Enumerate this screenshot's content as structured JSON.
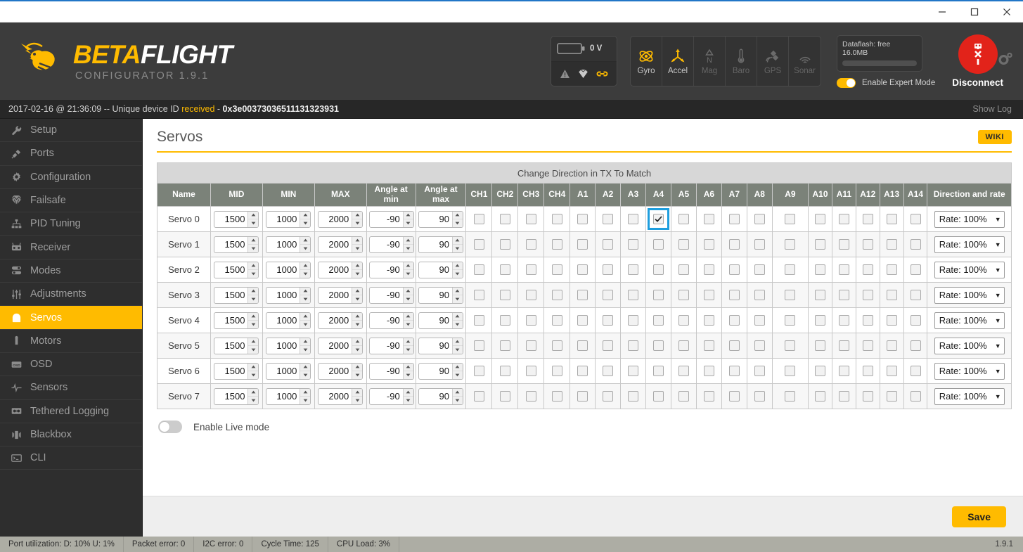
{
  "window": {
    "minimize_label": "minimize",
    "maximize_label": "maximize",
    "close_label": "close"
  },
  "header": {
    "brand_first": "BETA",
    "brand_second": "FLIGHT",
    "subtitle": "CONFIGURATOR  1.9.1",
    "battery": {
      "voltage": "0 V"
    },
    "sensors": [
      {
        "name": "Gyro",
        "label": "Gyro",
        "active": true
      },
      {
        "name": "Accel",
        "label": "Accel",
        "active": true
      },
      {
        "name": "Mag",
        "label": "Mag",
        "active": false
      },
      {
        "name": "Baro",
        "label": "Baro",
        "active": false
      },
      {
        "name": "GPS",
        "label": "GPS",
        "active": false
      },
      {
        "name": "Sonar",
        "label": "Sonar",
        "active": false
      }
    ],
    "dataflash_label": "Dataflash: free 16.0MB",
    "expert_mode_label": "Enable Expert Mode",
    "expert_mode_on": true,
    "disconnect_label": "Disconnect"
  },
  "log": {
    "timestamp": "2017-02-16 @ 21:36:09",
    "separator": " -- ",
    "message": "Unique device ID ",
    "status_word": "received",
    "dash": " - ",
    "device_id": "0x3e00373036511131323931",
    "show_log_label": "Show Log"
  },
  "sidebar": {
    "items": [
      {
        "label": "Setup",
        "icon": "wrench-icon",
        "active": false
      },
      {
        "label": "Ports",
        "icon": "plug-icon",
        "active": false
      },
      {
        "label": "Configuration",
        "icon": "gear-icon",
        "active": false
      },
      {
        "label": "Failsafe",
        "icon": "parachute-icon",
        "active": false
      },
      {
        "label": "PID Tuning",
        "icon": "sitemap-icon",
        "active": false
      },
      {
        "label": "Receiver",
        "icon": "transmitter-icon",
        "active": false
      },
      {
        "label": "Modes",
        "icon": "switches-icon",
        "active": false
      },
      {
        "label": "Adjustments",
        "icon": "sliders-icon",
        "active": false
      },
      {
        "label": "Servos",
        "icon": "servo-icon",
        "active": true
      },
      {
        "label": "Motors",
        "icon": "motor-icon",
        "active": false
      },
      {
        "label": "OSD",
        "icon": "osd-icon",
        "active": false
      },
      {
        "label": "Sensors",
        "icon": "waveform-icon",
        "active": false
      },
      {
        "label": "Tethered Logging",
        "icon": "cassette-icon",
        "active": false
      },
      {
        "label": "Blackbox",
        "icon": "blackbox-icon",
        "active": false
      },
      {
        "label": "CLI",
        "icon": "terminal-icon",
        "active": false
      }
    ]
  },
  "page": {
    "title": "Servos",
    "wiki_label": "WIKI",
    "band_label": "Change Direction in TX To Match",
    "live_mode_label": "Enable Live mode",
    "live_mode_on": false,
    "save_label": "Save"
  },
  "table": {
    "columns": [
      "Name",
      "MID",
      "MIN",
      "MAX",
      "Angle at min",
      "Angle at max",
      "CH1",
      "CH2",
      "CH3",
      "CH4",
      "A1",
      "A2",
      "A3",
      "A4",
      "A5",
      "A6",
      "A7",
      "A8",
      "A9",
      "A10",
      "A11",
      "A12",
      "A13",
      "A14",
      "Direction and rate"
    ],
    "channel_columns": [
      "CH1",
      "CH2",
      "CH3",
      "CH4",
      "A1",
      "A2",
      "A3",
      "A4",
      "A5",
      "A6",
      "A7",
      "A8",
      "A9",
      "A10",
      "A11",
      "A12",
      "A13",
      "A14"
    ],
    "rows": [
      {
        "name": "Servo 0",
        "mid": "1500",
        "min": "1000",
        "max": "2000",
        "angle_min": "-90",
        "angle_max": "90",
        "checked": [
          "A4"
        ],
        "focused": "A4",
        "rate": "Rate: 100%"
      },
      {
        "name": "Servo 1",
        "mid": "1500",
        "min": "1000",
        "max": "2000",
        "angle_min": "-90",
        "angle_max": "90",
        "checked": [],
        "focused": "",
        "rate": "Rate: 100%"
      },
      {
        "name": "Servo 2",
        "mid": "1500",
        "min": "1000",
        "max": "2000",
        "angle_min": "-90",
        "angle_max": "90",
        "checked": [],
        "focused": "",
        "rate": "Rate: 100%"
      },
      {
        "name": "Servo 3",
        "mid": "1500",
        "min": "1000",
        "max": "2000",
        "angle_min": "-90",
        "angle_max": "90",
        "checked": [],
        "focused": "",
        "rate": "Rate: 100%"
      },
      {
        "name": "Servo 4",
        "mid": "1500",
        "min": "1000",
        "max": "2000",
        "angle_min": "-90",
        "angle_max": "90",
        "checked": [],
        "focused": "",
        "rate": "Rate: 100%"
      },
      {
        "name": "Servo 5",
        "mid": "1500",
        "min": "1000",
        "max": "2000",
        "angle_min": "-90",
        "angle_max": "90",
        "checked": [],
        "focused": "",
        "rate": "Rate: 100%"
      },
      {
        "name": "Servo 6",
        "mid": "1500",
        "min": "1000",
        "max": "2000",
        "angle_min": "-90",
        "angle_max": "90",
        "checked": [],
        "focused": "",
        "rate": "Rate: 100%"
      },
      {
        "name": "Servo 7",
        "mid": "1500",
        "min": "1000",
        "max": "2000",
        "angle_min": "-90",
        "angle_max": "90",
        "checked": [],
        "focused": "",
        "rate": "Rate: 100%"
      }
    ]
  },
  "statusbar": {
    "items": [
      "Port utilization: D: 10% U: 1%",
      "Packet error: 0",
      "I2C error: 0",
      "Cycle Time: 125",
      "CPU Load: 3%"
    ],
    "version": "1.9.1"
  },
  "colors": {
    "accent": "#ffbb00",
    "danger": "#e2231a",
    "focus": "#1e9ede",
    "header_bg": "#3c3c3c",
    "table_header_bg": "#7b8279"
  }
}
